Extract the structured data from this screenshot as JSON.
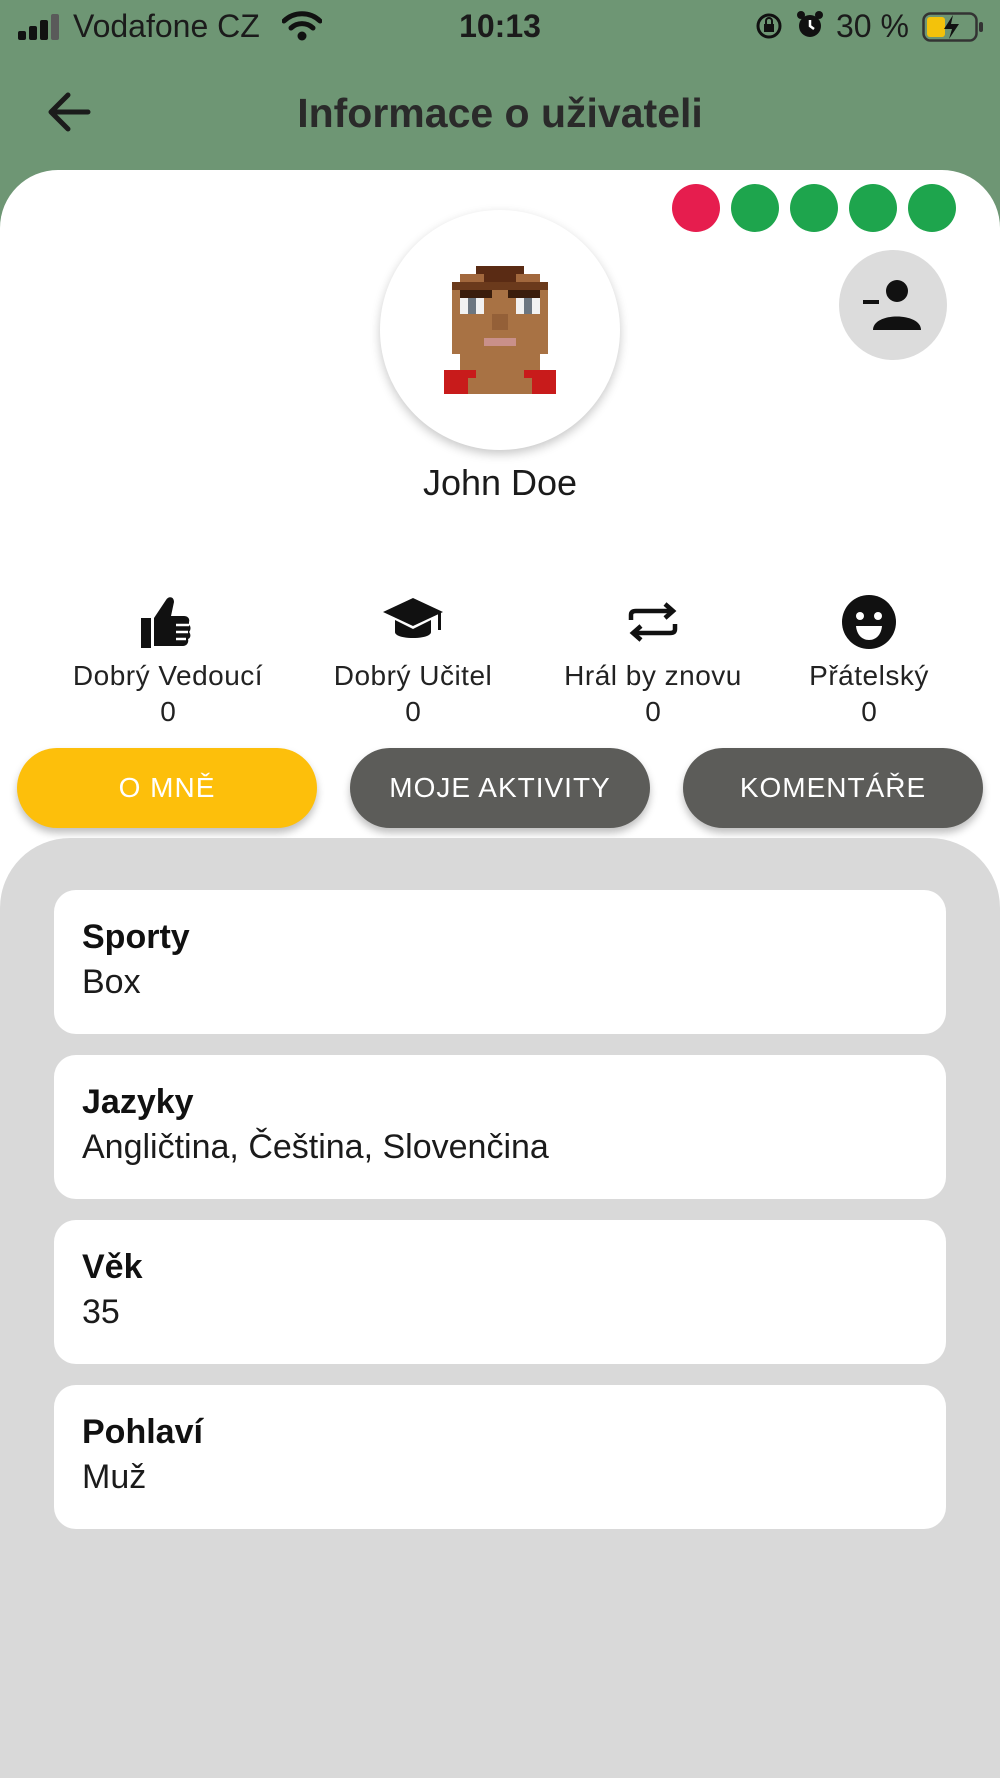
{
  "status_bar": {
    "carrier": "Vodafone CZ",
    "time": "10:13",
    "battery": "30 %"
  },
  "app_bar": {
    "title": "Informace o uživateli",
    "back_icon": "arrow-left-icon"
  },
  "profile": {
    "name": "John Doe",
    "status_dots": [
      "#e61d4e",
      "#1ea54d",
      "#1ea54d",
      "#1ea54d",
      "#1ea54d"
    ],
    "remove_friend_icon": "person-remove-icon"
  },
  "ratings": [
    {
      "icon": "thumbs-up-icon",
      "label": "Dobrý Vedoucí",
      "value": "0"
    },
    {
      "icon": "graduation-cap-icon",
      "label": "Dobrý Učitel",
      "value": "0"
    },
    {
      "icon": "repeat-icon",
      "label": "Hrál by znovu",
      "value": "0"
    },
    {
      "icon": "smiley-icon",
      "label": "Přátelský",
      "value": "0"
    }
  ],
  "tabs": [
    {
      "label": "O MNĚ",
      "active": true
    },
    {
      "label": "MOJE AKTIVITY",
      "active": false
    },
    {
      "label": "KOMENTÁŘE",
      "active": false
    }
  ],
  "about": [
    {
      "title": "Sporty",
      "value": "Box"
    },
    {
      "title": "Jazyky",
      "value": "Angličtina, Čeština, Slovenčina"
    },
    {
      "title": "Věk",
      "value": "35"
    },
    {
      "title": "Pohlaví",
      "value": "Muž"
    }
  ],
  "colors": {
    "header_bg": "#6e9674",
    "tab_active": "#fdbf0b",
    "tab_inactive": "#5c5c59",
    "panel_bg": "#d9d9d9"
  }
}
